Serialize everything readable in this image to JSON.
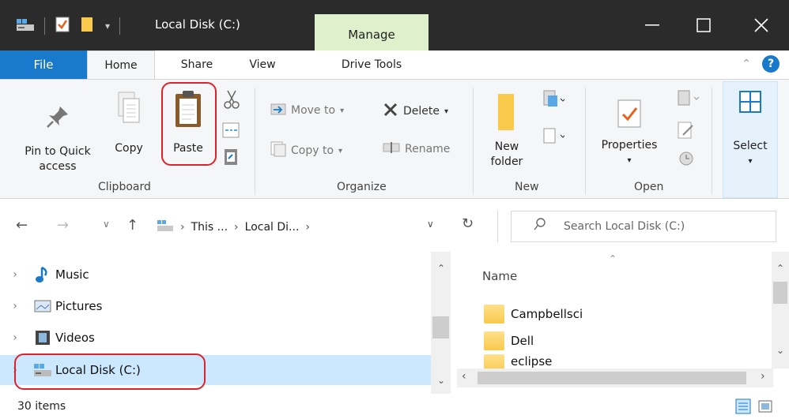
{
  "window": {
    "title": "Local Disk (C:)",
    "manage_tab": "Manage"
  },
  "tabs": {
    "file": "File",
    "home": "Home",
    "share": "Share",
    "view": "View",
    "drive_tools": "Drive Tools"
  },
  "ribbon": {
    "clipboard": {
      "pin_label_1": "Pin to Quick",
      "pin_label_2": "access",
      "copy": "Copy",
      "paste": "Paste",
      "group": "Clipboard"
    },
    "organize": {
      "move_to": "Move to",
      "copy_to": "Copy to",
      "delete": "Delete",
      "rename": "Rename",
      "group": "Organize"
    },
    "new": {
      "new_folder_1": "New",
      "new_folder_2": "folder",
      "group": "New"
    },
    "open": {
      "properties": "Properties",
      "group": "Open"
    },
    "select": {
      "select": "Select"
    }
  },
  "address": {
    "crumb1": "This ...",
    "crumb2": "Local Di...",
    "search_placeholder": "Search Local Disk (C:)"
  },
  "nav_tree": [
    {
      "label": "Music",
      "icon": "music-icon"
    },
    {
      "label": "Pictures",
      "icon": "pictures-icon"
    },
    {
      "label": "Videos",
      "icon": "videos-icon"
    },
    {
      "label": "Local Disk (C:)",
      "icon": "drive-icon",
      "selected": true
    }
  ],
  "content": {
    "column_name": "Name",
    "files": [
      "Campbellsci",
      "Dell",
      "eclipse"
    ]
  },
  "status": {
    "items": "30 items"
  },
  "colors": {
    "accent": "#1979ca",
    "highlight": "#e0202a",
    "selected": "#cce8ff",
    "manage": "#dff1cc"
  }
}
